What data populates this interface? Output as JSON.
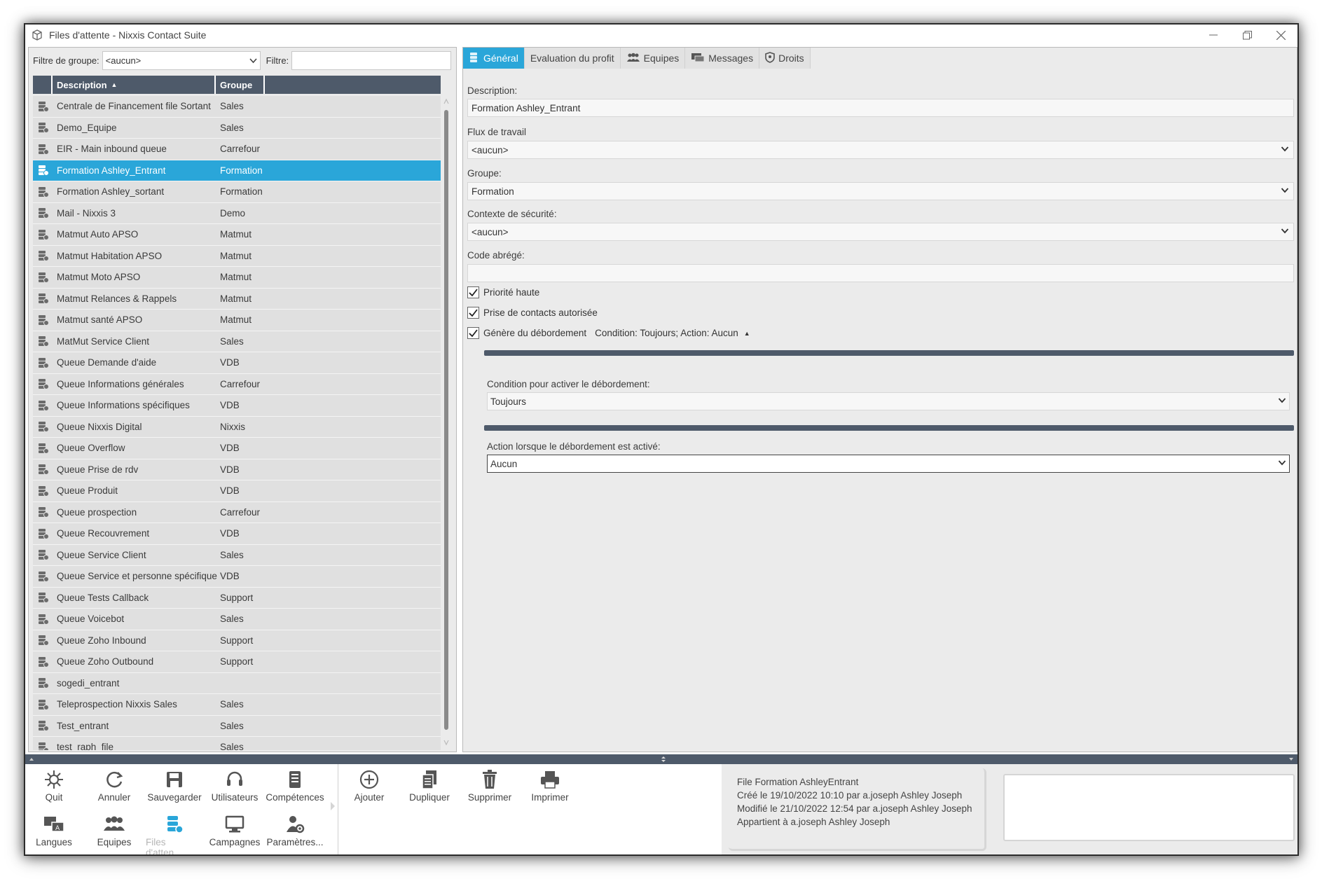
{
  "window": {
    "title": "Files d'attente - Nixxis Contact Suite"
  },
  "filter": {
    "group_label": "Filtre de groupe:",
    "group_value": "<aucun>",
    "filter_label": "Filtre:",
    "filter_value": ""
  },
  "grid": {
    "columns": [
      "Description",
      "Groupe"
    ],
    "rows": [
      {
        "desc": "Centrale de Financement file Sortant",
        "group": "Sales"
      },
      {
        "desc": "Demo_Equipe",
        "group": "Sales"
      },
      {
        "desc": "EIR - Main inbound queue",
        "group": "Carrefour"
      },
      {
        "desc": "Formation Ashley_Entrant",
        "group": "Formation",
        "selected": true
      },
      {
        "desc": "Formation Ashley_sortant",
        "group": "Formation"
      },
      {
        "desc": "Mail - Nixxis 3",
        "group": "Demo"
      },
      {
        "desc": "Matmut Auto APSO",
        "group": "Matmut"
      },
      {
        "desc": "Matmut Habitation APSO",
        "group": "Matmut"
      },
      {
        "desc": "Matmut Moto APSO",
        "group": "Matmut"
      },
      {
        "desc": "Matmut Relances & Rappels",
        "group": "Matmut"
      },
      {
        "desc": "Matmut santé APSO",
        "group": "Matmut"
      },
      {
        "desc": "MatMut Service Client",
        "group": "Sales"
      },
      {
        "desc": "Queue Demande d'aide",
        "group": "VDB"
      },
      {
        "desc": "Queue Informations générales",
        "group": "Carrefour"
      },
      {
        "desc": "Queue Informations spécifiques",
        "group": "VDB"
      },
      {
        "desc": "Queue Nixxis Digital",
        "group": "Nixxis"
      },
      {
        "desc": "Queue Overflow",
        "group": "VDB"
      },
      {
        "desc": "Queue Prise de rdv",
        "group": "VDB"
      },
      {
        "desc": "Queue Produit",
        "group": "VDB"
      },
      {
        "desc": "Queue prospection",
        "group": "Carrefour"
      },
      {
        "desc": "Queue Recouvrement",
        "group": "VDB"
      },
      {
        "desc": "Queue Service Client",
        "group": "Sales"
      },
      {
        "desc": "Queue Service et personne spécifique",
        "group": "VDB"
      },
      {
        "desc": "Queue Tests Callback",
        "group": "Support"
      },
      {
        "desc": "Queue Voicebot",
        "group": "Sales"
      },
      {
        "desc": "Queue Zoho Inbound",
        "group": "Support"
      },
      {
        "desc": "Queue Zoho Outbound",
        "group": "Support"
      },
      {
        "desc": "sogedi_entrant",
        "group": ""
      },
      {
        "desc": "Teleprospection Nixxis Sales",
        "group": "Sales"
      },
      {
        "desc": "Test_entrant",
        "group": "Sales"
      },
      {
        "desc": "test_raph_file",
        "group": "Sales"
      }
    ]
  },
  "tabs": [
    "Général",
    "Evaluation du profit",
    "Equipes",
    "Messages",
    "Droits"
  ],
  "form": {
    "description_label": "Description:",
    "description_value": "Formation Ashley_Entrant",
    "workflow_label": "Flux de travail",
    "workflow_value": "<aucun>",
    "group_label": "Groupe:",
    "group_value": "Formation",
    "security_label": "Contexte de sécurité:",
    "security_value": "<aucun>",
    "code_label": "Code abrégé:",
    "code_value": "",
    "check_priority": "Priorité haute",
    "check_contacts": "Prise de contacts autorisée",
    "check_overflow": "Génère du débordement",
    "overflow_summary": "Condition: Toujours; Action: Aucun",
    "overflow_condition_label": "Condition pour activer le débordement:",
    "overflow_condition_value": "Toujours",
    "overflow_action_label": "Action lorsque le débordement est activé:",
    "overflow_action_value": "Aucun"
  },
  "toolbar": {
    "quit": "Quit",
    "cancel": "Annuler",
    "save": "Sauvegarder",
    "users": "Utilisateurs",
    "skills": "Compétences",
    "languages": "Langues",
    "teams": "Equipes",
    "queues": "Files d'atten...",
    "campaigns": "Campagnes",
    "settings": "Paramètres...",
    "add": "Ajouter",
    "duplicate": "Dupliquer",
    "delete": "Supprimer",
    "print": "Imprimer"
  },
  "info": {
    "line1": "File Formation AshleyEntrant",
    "line2": "Créé le 19/10/2022 10:10 par a.joseph Ashley Joseph",
    "line3": "Modifié le 21/10/2022 12:54 par a.joseph Ashley Joseph",
    "line4": "Appartient à a.joseph Ashley Joseph"
  },
  "colors": {
    "accent": "#2aa6d9",
    "header": "#4e5a6a",
    "panel": "#ebebeb"
  }
}
